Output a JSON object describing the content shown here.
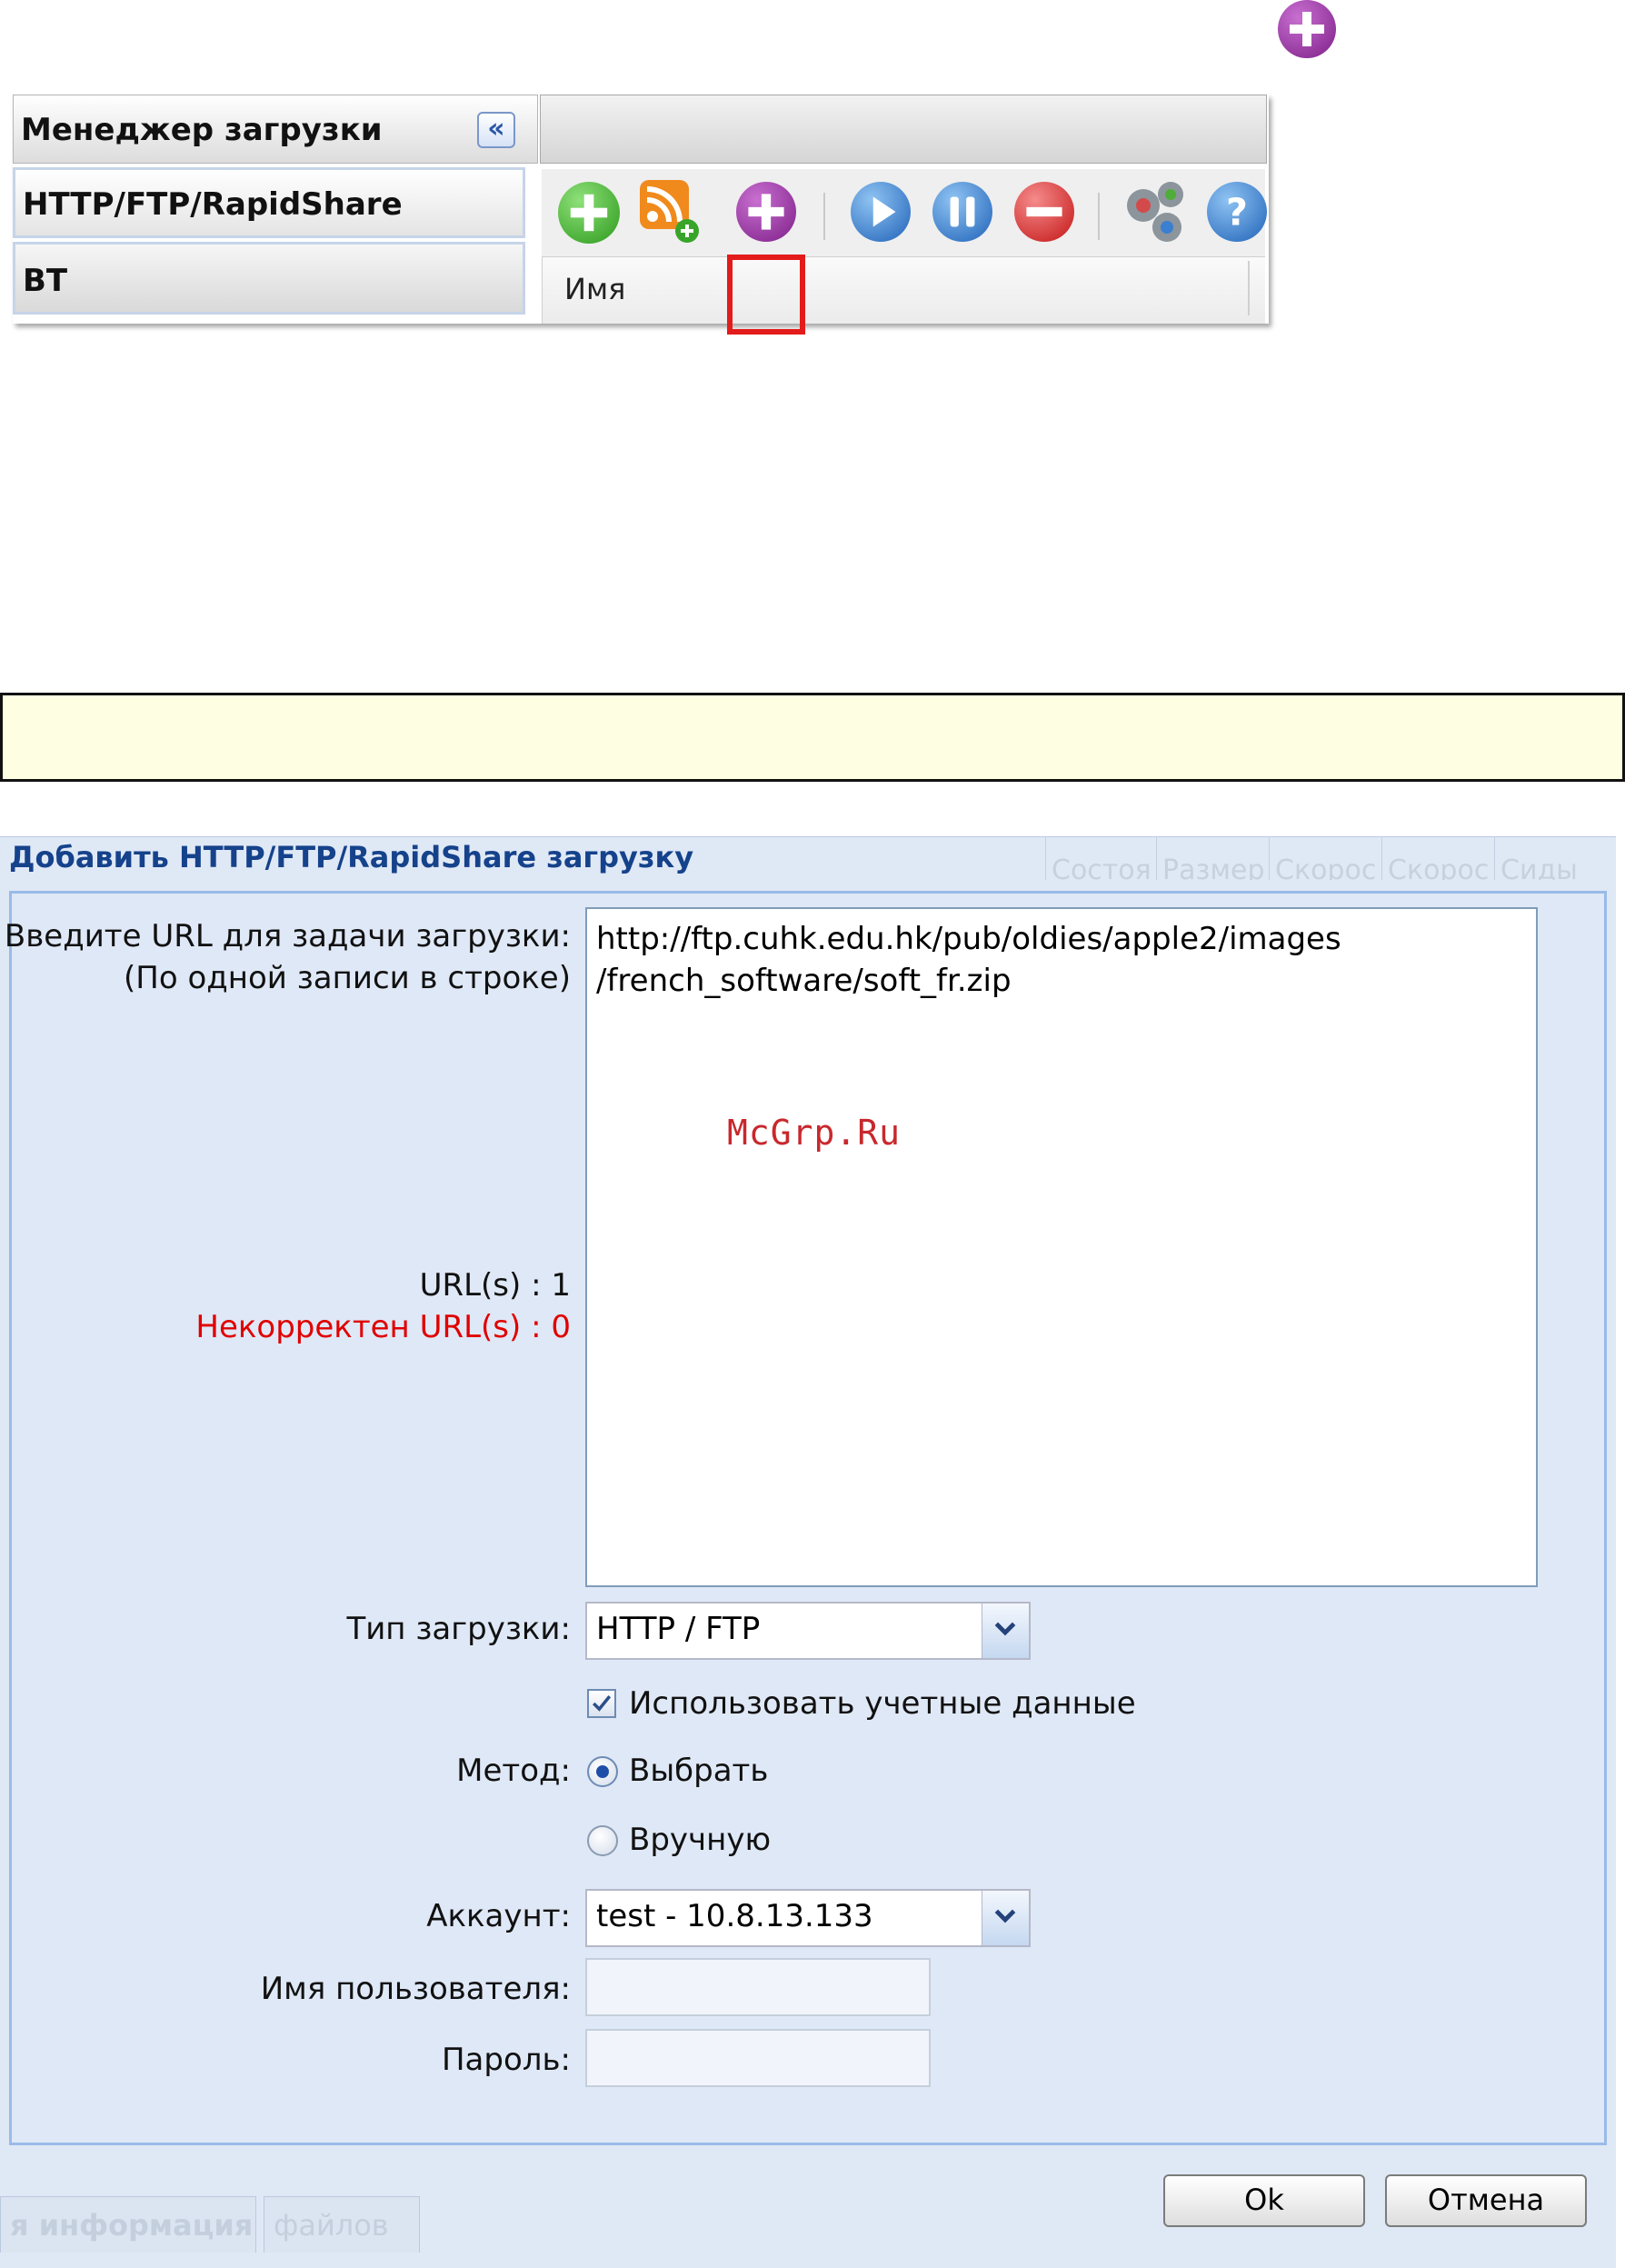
{
  "download_manager": {
    "title": "Менеджер загрузки",
    "collapse_glyph": "«",
    "items": [
      {
        "label": "HTTP/FTP/RapidShare"
      },
      {
        "label": "BT"
      }
    ],
    "column_header": "Имя",
    "toolbar": {
      "icons": [
        "add-icon",
        "rss-add-icon",
        "add-url-icon",
        "start-icon",
        "pause-icon",
        "remove-icon",
        "settings-icon",
        "help-icon"
      ],
      "highlighted": "add-url-icon"
    }
  },
  "colors": {
    "add_green": "#3fae2a",
    "add_url_purple": "#8a2a94",
    "play_blue": "#2c73c8",
    "remove_red": "#d52222",
    "highlight_red": "#e41b1b",
    "dialog_title_blue": "#15428b",
    "invalid_red": "#e00000",
    "watermark_red": "#c8282d"
  },
  "dialog": {
    "title": "Добавить HTTP/FTP/RapidShare загрузку",
    "background_columns": [
      "Состоя",
      "Размер",
      "Скорос",
      "Скорос",
      "Сиды"
    ],
    "url_label_line1": "Введите URL для задачи загрузки:",
    "url_label_line2": "(По одной записи в строке)",
    "url_value": "http://ftp.cuhk.edu.hk/pub/oldies/apple2/images\n/french_software/soft_fr.zip",
    "watermark": "McGrp.Ru",
    "url_count": "URL(s) : 1",
    "invalid_count": "Некорректен URL(s) : 0",
    "download_type_label": "Тип загрузки:",
    "download_type_value": "HTTP / FTP",
    "use_credentials_label": "Использовать учетные данные",
    "use_credentials_checked": true,
    "method_label": "Метод:",
    "method_options": [
      "Выбрать",
      "Вручную"
    ],
    "method_selected": "Выбрать",
    "account_label": "Аккаунт:",
    "account_value": "test - 10.8.13.133",
    "username_label": "Имя пользователя:",
    "password_label": "Пароль:",
    "ok_label": "Ok",
    "cancel_label": "Отмена",
    "background_tabs": [
      "я информация",
      "файлов"
    ]
  }
}
